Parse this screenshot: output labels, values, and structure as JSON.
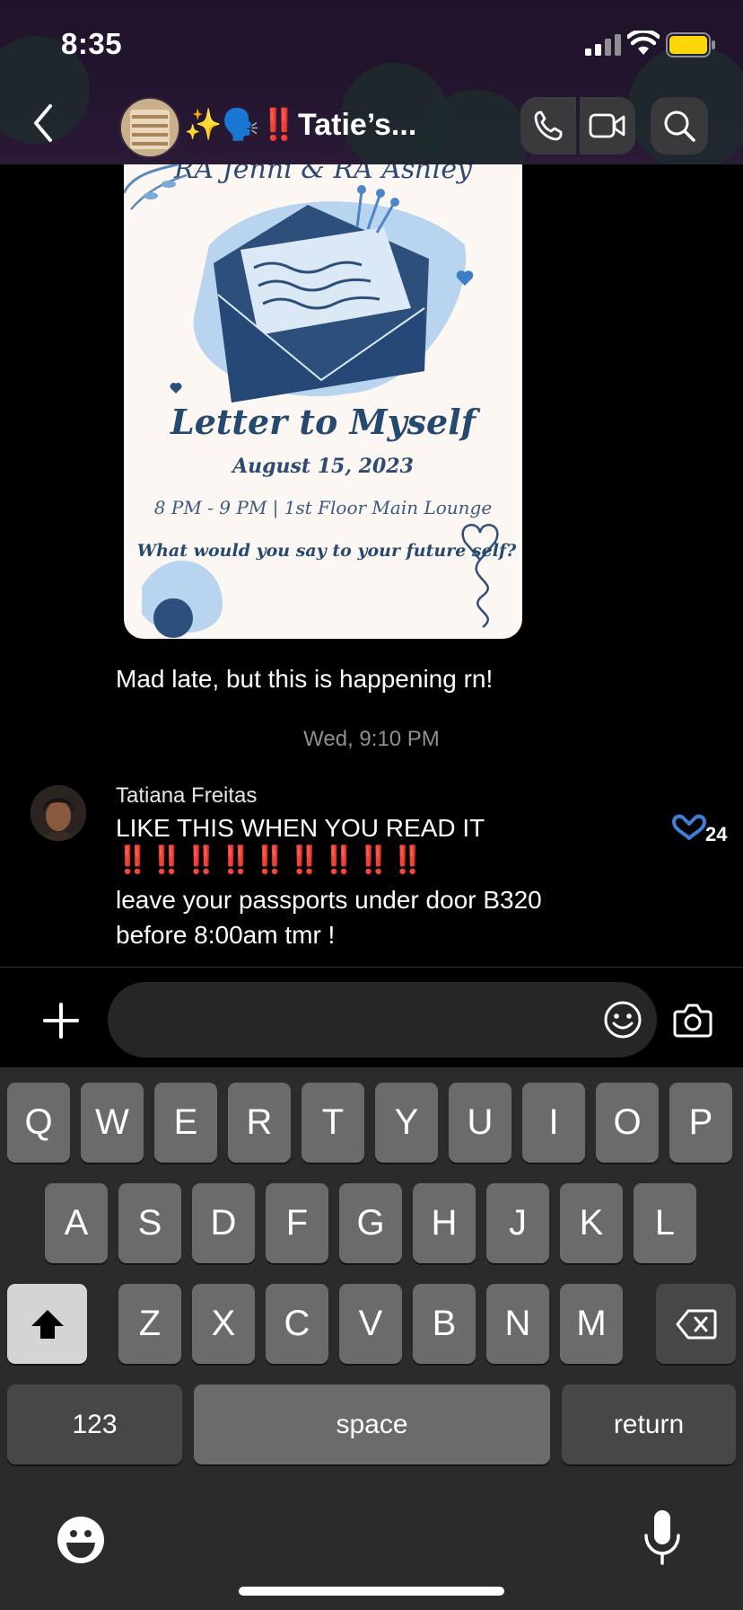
{
  "status_bar": {
    "time": "8:35"
  },
  "header": {
    "title": "✨🗣️‼️Tatie’s..."
  },
  "poster": {
    "top_text": "RA Jenni & RA Ashley",
    "title": "Letter to Myself",
    "date": "August 15, 2023",
    "time_place": "8 PM - 9 PM | 1st Floor Main Lounge",
    "question": "What would you say to your future self?"
  },
  "messages": {
    "caption": "Mad late, but this is happening rn!",
    "timestamp": "Wed, 9:10 PM",
    "sender": "Tatiana Freitas",
    "line1": "LIKE THIS WHEN YOU READ IT",
    "line2": "‼️‼️‼️‼️‼️‼️‼️‼️‼️",
    "line3": "leave your passports under door B320",
    "line4": "before 8:00am tmr !",
    "reaction_count": "24"
  },
  "composer": {
    "placeholder": ""
  },
  "keyboard": {
    "row1": [
      "Q",
      "W",
      "E",
      "R",
      "T",
      "Y",
      "U",
      "I",
      "O",
      "P"
    ],
    "row2": [
      "A",
      "S",
      "D",
      "F",
      "G",
      "H",
      "J",
      "K",
      "L"
    ],
    "row3": [
      "Z",
      "X",
      "C",
      "V",
      "B",
      "N",
      "M"
    ],
    "numbers": "123",
    "space": "space",
    "return": "return"
  },
  "colors": {
    "accent_reaction": "#3d7fd9",
    "exclamation": "#e0191b",
    "battery": "#ffd60a"
  }
}
